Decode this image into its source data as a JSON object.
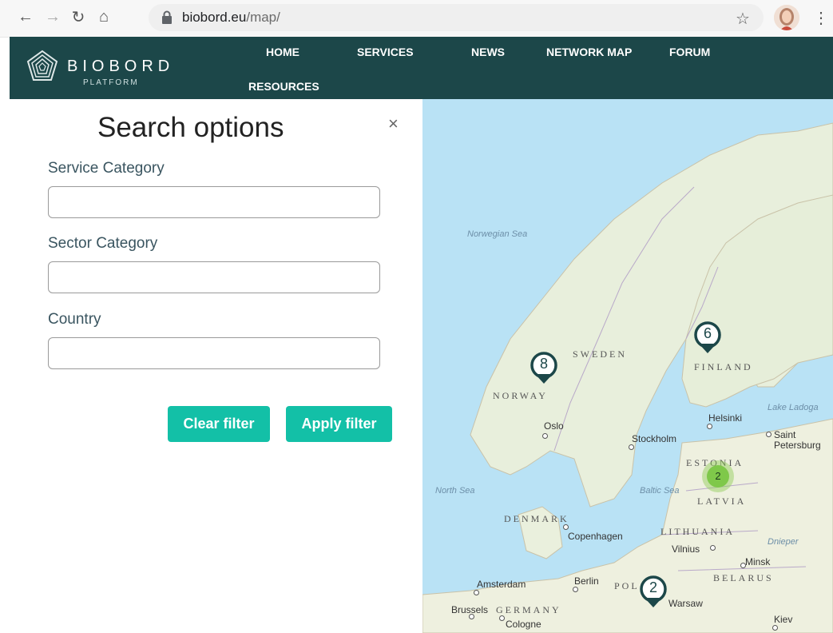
{
  "browser": {
    "url_domain": "biobord.eu",
    "url_path": "/map/"
  },
  "header": {
    "brand": "BIOBORD",
    "brand_sub": "PLATFORM",
    "menu": [
      "HOME",
      "SERVICES",
      "NEWS",
      "NETWORK MAP",
      "FORUM",
      "RESOURCES"
    ]
  },
  "sidebar": {
    "title": "Search options",
    "close": "×",
    "fields": [
      {
        "label": "Service Category",
        "value": ""
      },
      {
        "label": "Sector Category",
        "value": ""
      },
      {
        "label": "Country",
        "value": ""
      }
    ],
    "clear_label": "Clear filter",
    "apply_label": "Apply filter"
  },
  "map": {
    "countries": [
      "SWEDEN",
      "FINLAND",
      "NORWAY",
      "ESTONIA",
      "LATVIA",
      "LITHUANIA",
      "BELARUS",
      "DENMARK",
      "GERMANY",
      "POL"
    ],
    "seas": [
      "Norwegian Sea",
      "North Sea",
      "Baltic Sea",
      "Lake Ladoga",
      "Dnieper"
    ],
    "cities": [
      "Oslo",
      "Stockholm",
      "Helsinki",
      "Saint Petersburg",
      "Copenhagen",
      "Vilnius",
      "Minsk",
      "Amsterdam",
      "Berlin",
      "Warsaw",
      "Brussels",
      "Cologne",
      "Kiev"
    ],
    "markers": [
      {
        "count": "8",
        "country": "Norway"
      },
      {
        "count": "6",
        "country": "Finland"
      },
      {
        "count": "2",
        "country": "Poland"
      }
    ],
    "cluster": "2",
    "colors": {
      "marker": "#1c4749",
      "cluster": "#7fc84a",
      "accent": "#13c0a7",
      "header": "#1c4749"
    }
  }
}
